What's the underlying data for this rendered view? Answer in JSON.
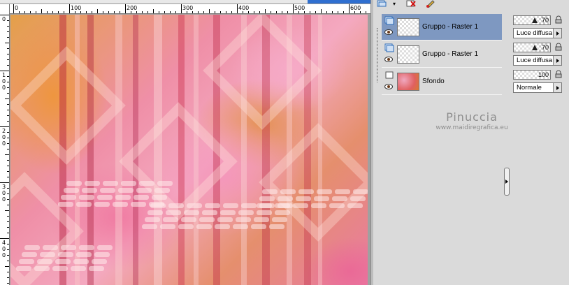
{
  "ruler": {
    "h_labels": [
      "0",
      "100",
      "200",
      "300",
      "400",
      "500",
      "600"
    ],
    "v_labels": [
      "0",
      "1 0 0",
      "2 0 0",
      "3 0 0",
      "4 0 0"
    ]
  },
  "layers": [
    {
      "name": "Gruppo - Raster 1",
      "opacity": "70",
      "opacity_fraction": 0.7,
      "blend_mode": "Luce diffusa",
      "selected": true,
      "group": true
    },
    {
      "name": "Gruppo - Raster 1",
      "opacity": "70",
      "opacity_fraction": 0.7,
      "blend_mode": "Luce diffusa",
      "selected": false,
      "group": true
    },
    {
      "name": "Sfondo",
      "opacity": "100",
      "opacity_fraction": 1.0,
      "blend_mode": "Normale",
      "selected": false,
      "group": false
    }
  ],
  "watermark": {
    "name": "Pinuccia",
    "url": "www.maidiregrafica.eu"
  },
  "colors": {
    "selection": "#7e98c1",
    "panel": "#dadada"
  }
}
